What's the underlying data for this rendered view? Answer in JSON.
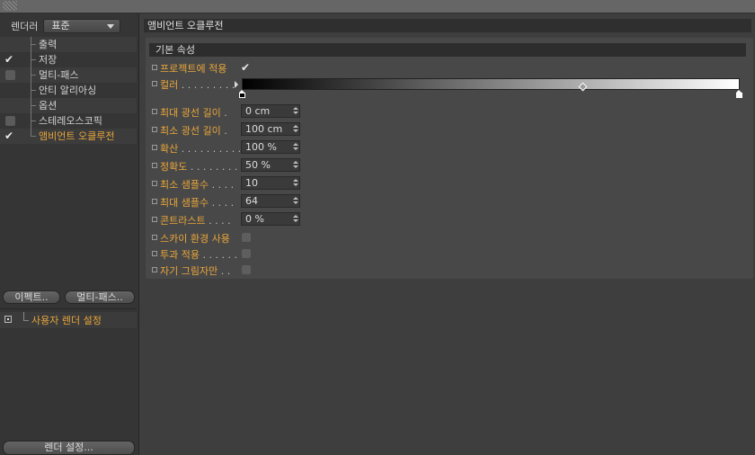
{
  "left": {
    "renderer_label": "렌더러",
    "renderer_value": "표준",
    "tree": [
      {
        "label": "출력",
        "checked": false,
        "checkbox": false,
        "active": false
      },
      {
        "label": "저장",
        "checked": true,
        "checkbox": false,
        "active": false
      },
      {
        "label": "멀티-패스",
        "checked": false,
        "checkbox": true,
        "active": false
      },
      {
        "label": "안티 알리아싱",
        "checked": false,
        "checkbox": false,
        "active": false
      },
      {
        "label": "옵션",
        "checked": false,
        "checkbox": false,
        "active": false
      },
      {
        "label": "스테레오스코픽",
        "checked": false,
        "checkbox": true,
        "active": false
      },
      {
        "label": "앰비언트 오클루전",
        "checked": true,
        "checkbox": false,
        "active": true
      }
    ],
    "effect_button": "이펙트..",
    "multipass_button": "멀티-패스..",
    "user_render_setting": "사용자 렌더 설정",
    "render_settings_button": "렌더 설정..."
  },
  "right": {
    "title": "앰비언트 오클루전",
    "section": "기본 속성",
    "apply_to_project": {
      "label": "프로젝트에 적용",
      "checked": true
    },
    "color": {
      "label": "컬러",
      "dots": " . . . . . . . . ."
    },
    "params": [
      {
        "label": "최대 광선 길이",
        "dots": " .",
        "value": "0 cm"
      },
      {
        "label": "최소 광선 길이",
        "dots": " .",
        "value": "100 cm"
      },
      {
        "label": "확산",
        "dots": " . . . . . . . . . .",
        "value": "100 %"
      },
      {
        "label": "정확도",
        "dots": " . . . . . . . . .",
        "value": "50 %"
      },
      {
        "label": "최소 샘플수",
        "dots": " . . . .",
        "value": "10"
      },
      {
        "label": "최대 샘플수",
        "dots": " . . . .",
        "value": "64"
      },
      {
        "label": "콘트라스트",
        "dots": " . . . .",
        "value": "0 %"
      }
    ],
    "checks": [
      {
        "label": "스카이 환경 사용",
        "dots": ""
      },
      {
        "label": "투과 적용",
        "dots": " . . . . . ."
      },
      {
        "label": "자기 그림자만",
        "dots": " . ."
      }
    ]
  },
  "colors": {
    "accent": "#e9a63a",
    "panel": "#484848",
    "left_panel": "#353535"
  }
}
